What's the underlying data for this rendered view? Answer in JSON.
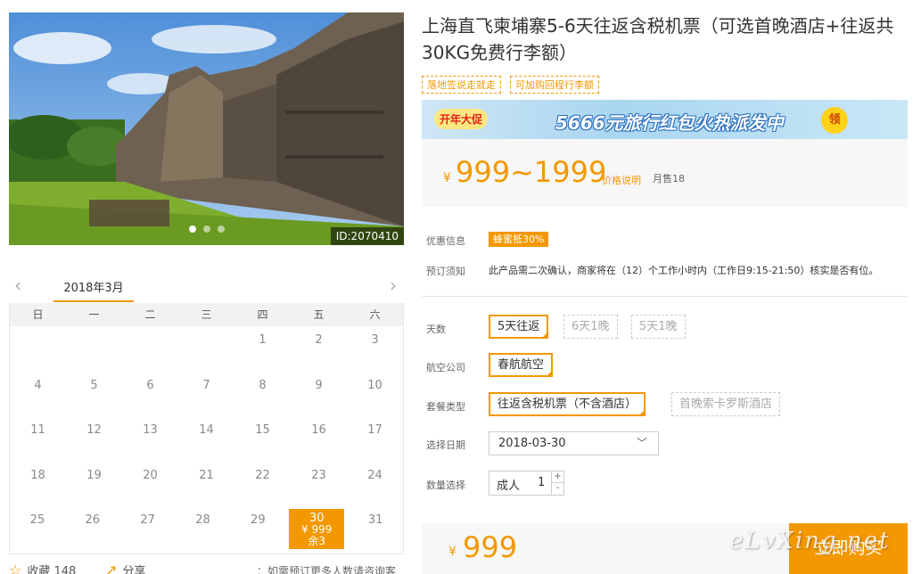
{
  "product": {
    "title": "上海直飞柬埔寨5-6天往返含税机票（可选首晚酒店+往返共30KG免费行李额）",
    "image_id": "ID:2070410",
    "tags": [
      "落地签说走就走",
      "可加购回程行李额"
    ]
  },
  "banner": {
    "badge": "开年大促",
    "text": "5666元旅行红包火热派发中",
    "button": "领"
  },
  "price": {
    "currency": "¥",
    "range": "999~1999",
    "explain": "价格说明",
    "sold": "月售18"
  },
  "info": {
    "promo_label": "优惠信息",
    "promo_value": "蜂蜜抵30%",
    "notice_label": "预订须知",
    "notice_value": "此产品需二次确认，商家将在（12）个工作小时内（工作日9:15-21:50）核实是否有位。"
  },
  "options": {
    "days_label": "天数",
    "days": [
      "5天往返",
      "6天1晚",
      "5天1晚"
    ],
    "airline_label": "航空公司",
    "airline": "春航航空",
    "package_label": "套餐类型",
    "packages": [
      "往返含税机票（不含酒店）",
      "首晚索卡罗斯酒店"
    ],
    "date_label": "选择日期",
    "date_value": "2018-03-30",
    "qty_label": "数量选择",
    "qty_type": "成人",
    "qty_value": "1",
    "plus": "+",
    "minus": "-"
  },
  "calendar": {
    "month": "2018年3月",
    "weekdays": [
      "日",
      "一",
      "二",
      "三",
      "四",
      "五",
      "六"
    ],
    "days": [
      [
        "",
        "",
        "",
        "",
        "1",
        "2",
        "3"
      ],
      [
        "4",
        "5",
        "6",
        "7",
        "8",
        "9",
        "10"
      ],
      [
        "11",
        "12",
        "13",
        "14",
        "15",
        "16",
        "17"
      ],
      [
        "18",
        "19",
        "20",
        "21",
        "22",
        "23",
        "24"
      ],
      [
        "25",
        "26",
        "27",
        "28",
        "29",
        "30",
        "31"
      ]
    ],
    "selected_day": "30",
    "selected_price": "¥ 999",
    "selected_stock": "余3"
  },
  "footer": {
    "fav": "收藏 148",
    "share": "分享",
    "note": "：如需预订更多人数请咨询客服"
  },
  "buy": {
    "currency": "¥",
    "amount": "999",
    "button": "立即购买"
  },
  "watermark": "eLvXing.net",
  "colors": {
    "accent": "#f39800",
    "banner_bg": "#a9d6f0"
  }
}
